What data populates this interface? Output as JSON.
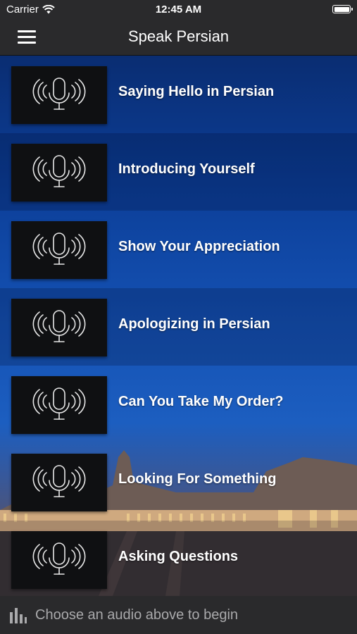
{
  "status": {
    "carrier": "Carrier",
    "time": "12:45 AM"
  },
  "nav": {
    "title": "Speak Persian",
    "menu_icon": "hamburger-icon"
  },
  "lessons": [
    {
      "label": "Saying Hello in Persian",
      "icon": "microphone-icon"
    },
    {
      "label": "Introducing Yourself",
      "icon": "microphone-icon"
    },
    {
      "label": "Show Your Appreciation",
      "icon": "microphone-icon"
    },
    {
      "label": "Apologizing in Persian",
      "icon": "microphone-icon"
    },
    {
      "label": "Can You Take My Order?",
      "icon": "microphone-icon"
    },
    {
      "label": "Looking For Something",
      "icon": "microphone-icon"
    },
    {
      "label": "Asking Questions",
      "icon": "microphone-icon"
    }
  ],
  "player": {
    "message": "Choose an audio above to begin",
    "icon": "audio-bars-icon"
  },
  "colors": {
    "bar_background": "#2a2a2c",
    "thumb_background": "#0f1012",
    "sky_top": "#0a2d72",
    "sky_mid": "#1c5ec0"
  }
}
